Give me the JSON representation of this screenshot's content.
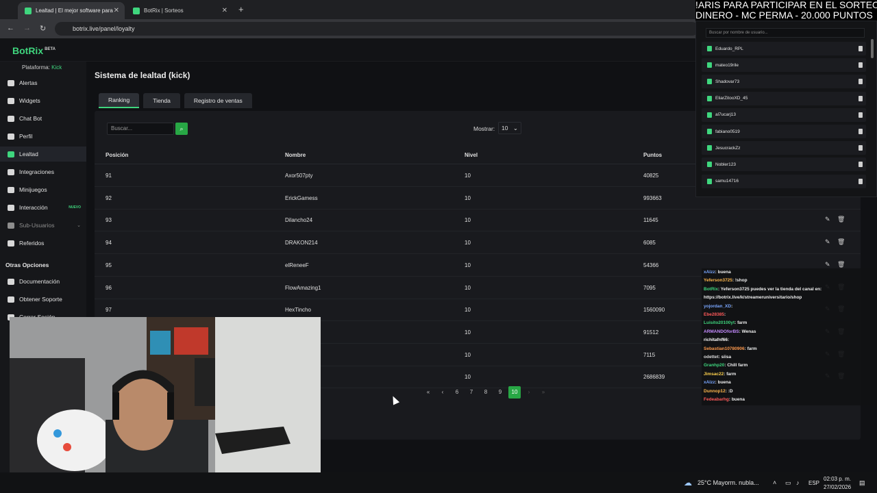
{
  "browser": {
    "tabs": [
      {
        "title": "Lealtad | El mejor software para",
        "active": true
      },
      {
        "title": "BotRix | Sorteos",
        "active": false
      }
    ],
    "new_tab": "+",
    "url": "botrix.live/panel/loyalty"
  },
  "app": {
    "logo": "BotRix",
    "logo_badge": "BETA",
    "platform_label": "Plataforma:",
    "platform_value": "Kick",
    "accent_color": "#3fd67e"
  },
  "sidebar": {
    "items": [
      {
        "label": "Alertas",
        "icon": "warning-icon"
      },
      {
        "label": "Widgets",
        "icon": "grid-icon"
      },
      {
        "label": "Chat Bot",
        "icon": "chat-icon"
      },
      {
        "label": "Perfil",
        "icon": "user-icon"
      },
      {
        "label": "Lealtad",
        "icon": "trophy-icon",
        "active": true
      },
      {
        "label": "Integraciones",
        "icon": "plug-icon"
      },
      {
        "label": "Minijuegos",
        "icon": "gamepad-icon"
      },
      {
        "label": "Interacción",
        "icon": "music-icon",
        "badge": "NUEVO"
      },
      {
        "label": "Sub-Usuarios",
        "icon": "users-icon",
        "dim": true
      },
      {
        "label": "Referidos",
        "icon": "group-icon"
      }
    ],
    "section2_title": "Otras Opciones",
    "section2_items": [
      {
        "label": "Documentación",
        "icon": "document-icon"
      },
      {
        "label": "Obtener Soporte",
        "icon": "help-icon"
      },
      {
        "label": "Cerrar Sesión",
        "icon": "logout-icon"
      }
    ]
  },
  "main": {
    "title": "Sistema de lealtad (kick)",
    "tabs": [
      "Ranking",
      "Tienda",
      "Registro de ventas"
    ],
    "search_placeholder": "Buscar...",
    "show_label": "Mostrar:",
    "show_value": "10",
    "columns": [
      "Posición",
      "Nombre",
      "Nivel",
      "Puntos"
    ],
    "rows": [
      {
        "pos": "91",
        "name": "Axor507pty",
        "level": "10",
        "points": "40825"
      },
      {
        "pos": "92",
        "name": "ErickGamess",
        "level": "10",
        "points": "993663"
      },
      {
        "pos": "93",
        "name": "Dilancho24",
        "level": "10",
        "points": "11645"
      },
      {
        "pos": "94",
        "name": "DRAKON214",
        "level": "10",
        "points": "6085"
      },
      {
        "pos": "95",
        "name": "elReneeF",
        "level": "10",
        "points": "54366"
      },
      {
        "pos": "96",
        "name": "FlowAmazing1",
        "level": "10",
        "points": "7095"
      },
      {
        "pos": "97",
        "name": "HexTincho",
        "level": "10",
        "points": "1560090"
      },
      {
        "pos": "",
        "name": "",
        "level": "10",
        "points": "91512"
      },
      {
        "pos": "",
        "name": "",
        "level": "10",
        "points": "7115"
      },
      {
        "pos": "",
        "name": "",
        "level": "10",
        "points": "2686839"
      }
    ],
    "pagination": {
      "first": "«",
      "prev": "‹",
      "pages": [
        "6",
        "7",
        "8",
        "9",
        "10"
      ],
      "current": "10",
      "next": "›",
      "last": "»"
    }
  },
  "overlay": {
    "banner_line1": "!ARIS PARA PARTICIPAR EN EL SORTEO:",
    "banner_line2": "DINERO - MC PERMA - 20.000 PUNTOS",
    "giveaway_search_placeholder": "Buscar por nombre de usuario...",
    "participants": [
      "Eduardo_RPL",
      "mateo19rile",
      "Shadovar73",
      "EliarZitooXD_45",
      "al7ucarj13",
      "fabiano0519",
      "JesucrackZz",
      "Nobler123",
      "samu14716"
    ]
  },
  "chat": {
    "messages": [
      {
        "user": "xAlzz",
        "text": ": buena",
        "color": "#7aa7ff"
      },
      {
        "user": "Yeferson3725",
        "text": ": !shop",
        "color": "#ffb84d"
      },
      {
        "user": "BotRix",
        "text": ": Yeferson3725 puedes ver la tienda del canal en:",
        "color": "#3fd67e"
      },
      {
        "user": "",
        "text": "https://botrix.live/k/streameruniversitario/shop",
        "color": "#ffffff"
      },
      {
        "user": "yojordan_XD",
        "text": ":",
        "color": "#7aa7ff"
      },
      {
        "user": "Ebe28385",
        "text": ":",
        "color": "#ff5a5a"
      },
      {
        "user": "Luisito20100yt",
        "text": ": farm",
        "color": "#3fd67e"
      },
      {
        "user": "ARMANDOforBS",
        "text": ": Wenas",
        "color": "#c58bff"
      },
      {
        "user": "richitafnf66",
        "text": ":",
        "color": "#ffffff"
      },
      {
        "user": "Sebastian10780906",
        "text": ": farm",
        "color": "#ff9a4d"
      },
      {
        "user": "odettet",
        "text": ": siisa",
        "color": "#dcdcdc"
      },
      {
        "user": "Granhp20",
        "text": ": Chill farm",
        "color": "#3fd67e"
      },
      {
        "user": "Jimsac22",
        "text": ": farm",
        "color": "#ffd24d"
      },
      {
        "user": "xAlzz",
        "text": ": buena",
        "color": "#7aa7ff"
      },
      {
        "user": "Dunnop12",
        "text": ": :D",
        "color": "#ffb84d"
      },
      {
        "user": "Fedeabarhg",
        "text": ": buena",
        "color": "#ff5a5a"
      }
    ]
  },
  "taskbar": {
    "weather": "25°C  Mayorm. nubla...",
    "lang": "ESP",
    "time": "02:03 p. m.",
    "date": "27/02/2026"
  }
}
